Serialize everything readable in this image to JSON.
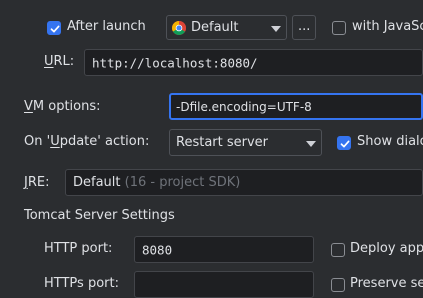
{
  "launch": {
    "after_launch_label": "After launch",
    "after_launch_checked": true,
    "browser_value": "Default",
    "browser_icon": "chrome-icon",
    "more_button_label": "...",
    "with_js_label": "with JavaSc"
  },
  "url": {
    "label_underlined": "U",
    "label_rest": "RL:",
    "value": "http://localhost:8080/"
  },
  "vm": {
    "label_underlined": "V",
    "label_rest": "M options:",
    "value": "-Dfile.encoding=UTF-8"
  },
  "update_action": {
    "label_pre": "On '",
    "label_underlined": "U",
    "label_post": "pdate' action:",
    "value": "Restart server",
    "show_dialog_label": "Show dialo",
    "show_dialog_checked": true
  },
  "jre": {
    "label_underlined": "J",
    "label_rest": "RE:",
    "value": "Default",
    "hint": "(16 - project SDK)"
  },
  "tomcat": {
    "section_title": "Tomcat Server Settings",
    "http_label": "HTTP port:",
    "http_value": "8080",
    "deploy_label": "Deploy appl",
    "https_label": "HTTPs port:",
    "https_value": "",
    "preserve_label": "Preserve se"
  },
  "colors": {
    "background": "#2b2d30",
    "field": "#1e1f22",
    "accent": "#3574f0",
    "text": "#dfe1e5",
    "muted": "#6f737a"
  }
}
